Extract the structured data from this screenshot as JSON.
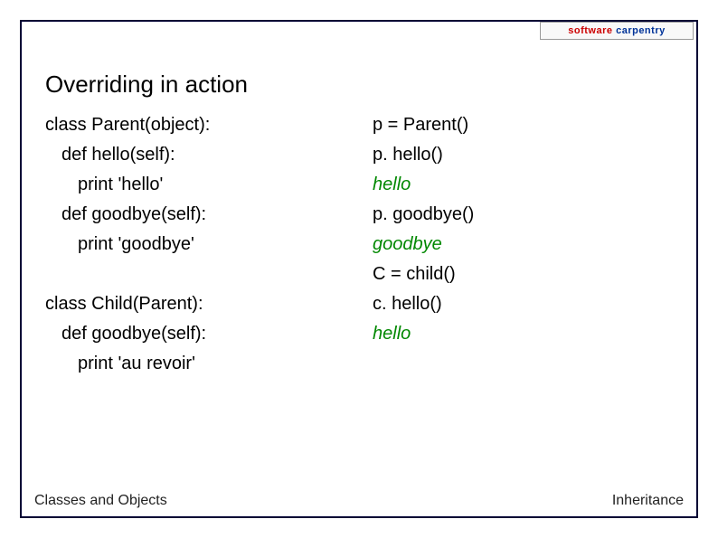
{
  "logo": {
    "software": "software",
    "carpentry": "carpentry"
  },
  "title": "Overriding in action",
  "left": {
    "l1": "class Parent(object):",
    "l2": "def hello(self):",
    "l3": "print 'hello'",
    "l4": "def goodbye(self):",
    "l5": "print 'goodbye'",
    "l6": "class Child(Parent):",
    "l7": "def goodbye(self):",
    "l8": "print 'au revoir'"
  },
  "right": {
    "r1": "p = Parent()",
    "r2": "p. hello()",
    "r3": "hello",
    "r4": "p. goodbye()",
    "r5": "goodbye",
    "r6": "C = child()",
    "r7": "c. hello()",
    "r8": "hello"
  },
  "footer": {
    "left": "Classes and Objects",
    "right": "Inheritance"
  }
}
